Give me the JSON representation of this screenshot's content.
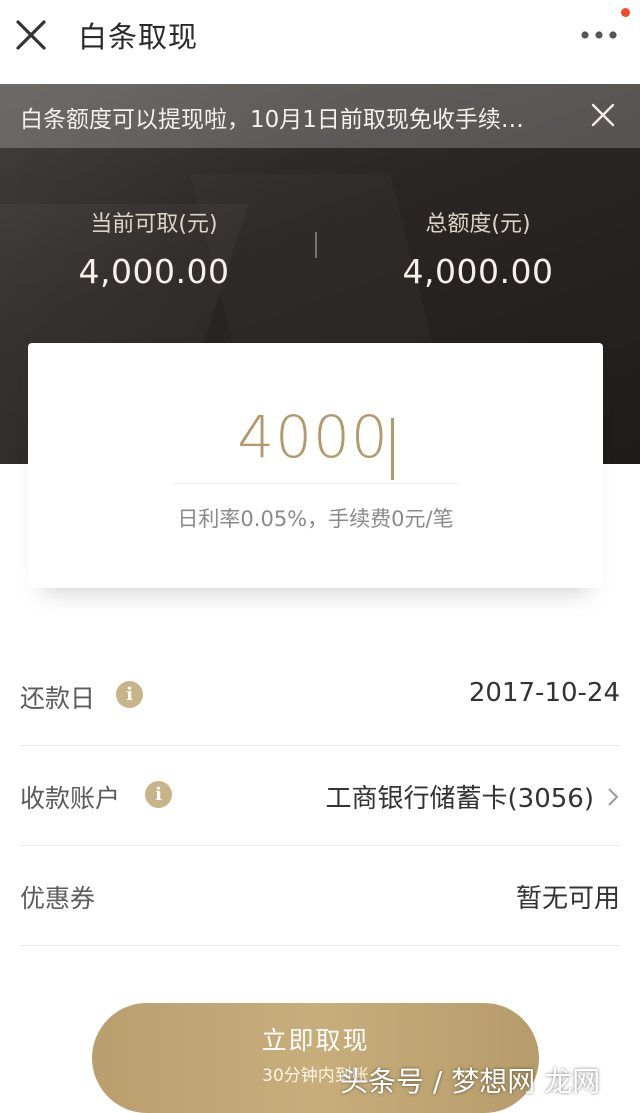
{
  "header": {
    "title": "白条取现",
    "close_icon": "close-icon",
    "more_icon": "more-dots-icon"
  },
  "notice": {
    "text": "白条额度可以提现啦，10月1日前取现免收手续…"
  },
  "stats": {
    "available_label": "当前可取(元)",
    "available_value": "4,000.00",
    "total_label": "总额度(元)",
    "total_value": "4,000.00"
  },
  "amount_input": {
    "value": "4000",
    "rate_text": "日利率0.05%，手续费0元/笔"
  },
  "rows": {
    "repay": {
      "label": "还款日",
      "value": "2017-10-24"
    },
    "account": {
      "label": "收款账户",
      "value": "工商银行储蓄卡(3056)"
    },
    "coupon": {
      "label": "优惠券",
      "value": "暂无可用"
    }
  },
  "cta": {
    "label": "立即取现",
    "sub": "30分钟内到账"
  },
  "watermark": "头条号 / 梦想网 龙网",
  "colors": {
    "accent": "#b39a6b",
    "notification_dot": "#f24a2b"
  }
}
